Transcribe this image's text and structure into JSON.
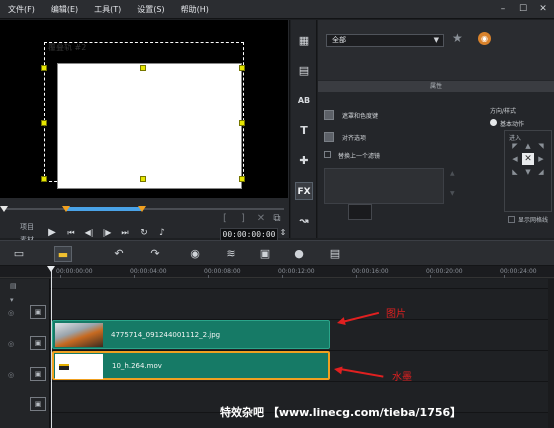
{
  "menu": {
    "items": [
      "文件(F)",
      "编辑(E)",
      "工具(T)",
      "设置(S)",
      "帮助(H)"
    ]
  },
  "preview": {
    "overlay_title": "覆叠轨 #2",
    "labels": {
      "project": "项目",
      "clip": "素材"
    },
    "timecode": "00:00:00:00"
  },
  "library": {
    "dropdown_value": "全部",
    "section_title": "属性",
    "options": {
      "mask": "遮罩和色度键",
      "align": "对齐选项",
      "replace_prev": "替换上一个滤镜"
    },
    "direction": {
      "label": "方向/样式",
      "basic_motion": "基本动作",
      "enter": "进入",
      "show_grid": "显示网格线"
    },
    "fx_label": "FX"
  },
  "timeline": {
    "ruler_ticks": [
      "00:00:00:00",
      "00:00:04:00",
      "00:00:08:00",
      "00:00:12:00",
      "00:00:16:00",
      "00:00:20:00",
      "00:00:24:00"
    ],
    "clips": {
      "image": {
        "label": "4775714_091244001112_2.jpg"
      },
      "video": {
        "label": "10_h.264.mov"
      }
    }
  },
  "annotations": {
    "image": "图片",
    "video": "水墨"
  },
  "watermark": "特效杂吧 【www.linecg.com/tieba/1756】",
  "colors": {
    "clip": "#167a66",
    "selection": "#f0a020",
    "annotation": "#e02020",
    "handle": "#e6e600"
  }
}
